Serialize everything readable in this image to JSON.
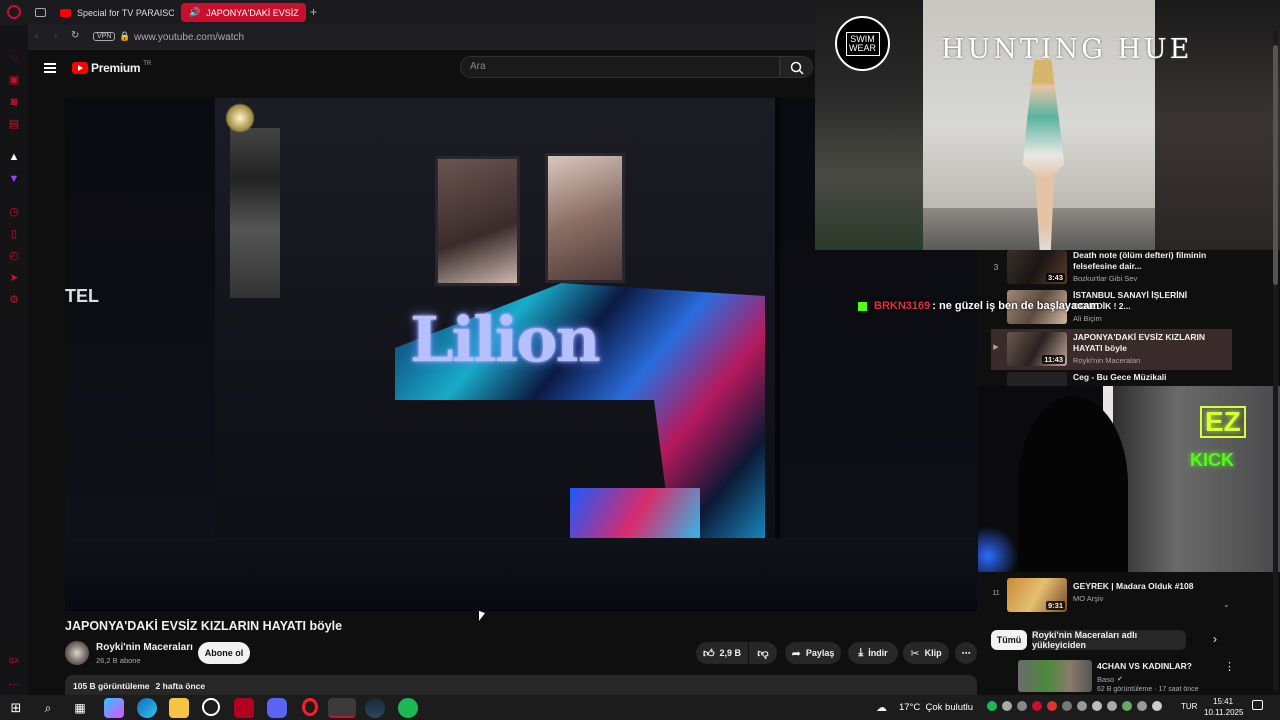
{
  "browser": {
    "tabs": [
      {
        "label": "Special for TV PARAISO M"
      },
      {
        "label": "JAPONYA'DAKİ EVSİZ"
      }
    ],
    "vpn_label": "VPN",
    "url": "www.youtube.com/watch"
  },
  "youtube": {
    "logo_text": "Premium",
    "logo_sup": "TR",
    "search_placeholder": "Ara"
  },
  "video": {
    "sign_text": "Lilion",
    "title": "JAPONYA'DAKİ EVSİZ KIZLARIN HAYATI böyle",
    "channel_name": "Royki'nin Maceraları",
    "subscribers": "26,2 B abone",
    "subscribe_label": "Abone ol",
    "likes": "2,9 B",
    "share_label": "Paylaş",
    "download_label": "İndir",
    "clip_label": "Klip",
    "views": "105 B görüntüleme",
    "age": "2 hafta önce"
  },
  "overlay": {
    "brand": "SWIM WEAR",
    "show_title": "HUNTING HUE",
    "chat_user": "BRKN3169",
    "chat_message": ": ne güzel iş ben de başlayacam",
    "kick_line1": "EZ",
    "kick_line2": "KICK"
  },
  "playlist": {
    "items": [
      {
        "index": "3",
        "title": "Death note (ölüm defteri) filminin felsefesine dair...",
        "channel": "Bozkurtlar Gibi Sev",
        "duration": "3:43"
      },
      {
        "index": "",
        "title": "İSTANBUL SANAYİ İŞLERİNİ DENEDİK ! 2...",
        "channel": "Ali Biçim",
        "duration": ""
      },
      {
        "index": "▶",
        "title": "JAPONYA'DAKİ EVSİZ KIZLARIN HAYATI böyle",
        "channel": "Royki'nin Maceraları",
        "duration": "11:43"
      },
      {
        "index": "",
        "title": "Ceg - Bu Gece Müzikali",
        "channel": "",
        "duration": ""
      },
      {
        "index": "11",
        "title": "GEYREK | Madara Olduk #108",
        "channel": "MO Arşiv",
        "duration": "9:31"
      }
    ]
  },
  "recommendations": {
    "chips": [
      "Tümü",
      "Royki'nin Maceraları adlı yükleyiciden"
    ],
    "items": [
      {
        "title": "4CHAN VS KADINLAR?",
        "channel": "Baso",
        "meta": "62 B görüntüleme · 17 saat önce"
      }
    ]
  },
  "taskbar": {
    "weather": "17°C  Çok bulutlu",
    "lang": "TUR",
    "time": "15:41",
    "date": "10.11.2025"
  },
  "colors": {
    "accent_red": "#c8102e",
    "yt_red": "#ff0000",
    "chat_name": "#e0303a"
  }
}
